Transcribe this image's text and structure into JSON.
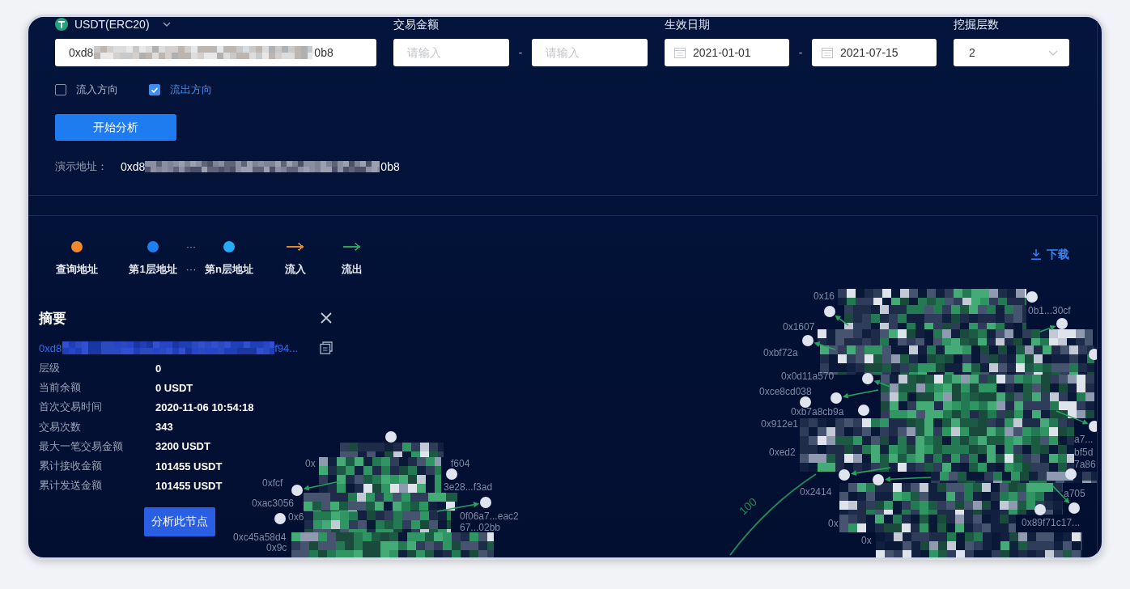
{
  "asset": {
    "label": "USDT(ERC20)"
  },
  "query": {
    "address": {
      "prefix": "0xd8",
      "suffix": "0b8"
    },
    "amount": {
      "label": "交易金额",
      "min_placeholder": "请输入",
      "separator": "-",
      "max_placeholder": "请输入"
    },
    "date_range": {
      "label": "生效日期",
      "start": "2021-01-01",
      "separator": "-",
      "end": "2021-07-15"
    },
    "depth": {
      "label": "挖掘层数",
      "value": "2"
    },
    "directions": [
      {
        "label": "流入方向",
        "checked": false
      },
      {
        "label": "流出方向",
        "checked": true
      }
    ],
    "start_button": "开始分析",
    "demo_address": {
      "label": "演示地址：",
      "prefix": "0xd8",
      "suffix": "0b8"
    }
  },
  "legend": {
    "items": [
      {
        "kind": "dot",
        "label": "查询地址",
        "color": "#f0892e"
      },
      {
        "kind": "dot",
        "label": "第1层地址",
        "color": "#1f7ff0"
      },
      {
        "kind": "gap",
        "mark": "···",
        "label": "···"
      },
      {
        "kind": "dot",
        "label": "第n层地址",
        "color": "#27aaf7"
      },
      {
        "kind": "arrow",
        "label": "流入",
        "color": "#e4882c"
      },
      {
        "kind": "arrow",
        "label": "流出",
        "color": "#2aa35f"
      }
    ],
    "download": "下载"
  },
  "summary": {
    "title": "摘要",
    "address": {
      "prefix": "0xd8",
      "suffix": "f94..."
    },
    "rows": [
      {
        "label": "层级",
        "value": "0"
      },
      {
        "label": "当前余额",
        "value": "0 USDT"
      },
      {
        "label": "首次交易时间",
        "value": "2020-11-06 10:54:18"
      },
      {
        "label": "交易次数",
        "value": "343"
      },
      {
        "label": "最大一笔交易金额",
        "value": "3200 USDT"
      },
      {
        "label": "累计接收金额",
        "value": "101455 USDT"
      },
      {
        "label": "累计发送金额",
        "value": "101455 USDT"
      }
    ],
    "button": "分析此节点"
  },
  "graph": {
    "edge_label": "100",
    "clusters": [
      {
        "labels": [
          "0x16",
          "0b1...30cf",
          "0x1607",
          "0xbf72a",
          "0x0d11a570",
          "0xce8cd038",
          "0xb7a8cb9a",
          "0x912e1",
          "a7...",
          "0xed2",
          "bf5d",
          "7a86",
          "0x2414",
          "a705",
          "0x",
          "0x89f71c17...",
          "0x"
        ]
      },
      {
        "labels": [
          "0x",
          "f604",
          "0xfcf",
          "3e28...f3ad",
          "0xac3056",
          "0x6",
          "0f06a7...eac2",
          "67...02bb",
          "0xc45a58d4",
          "0x9c"
        ]
      }
    ]
  }
}
